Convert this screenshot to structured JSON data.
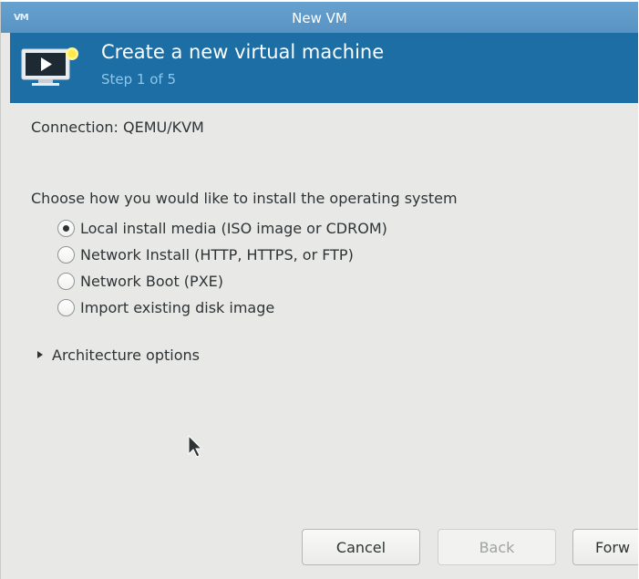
{
  "window": {
    "app_icon_text": "VM",
    "title": "New VM"
  },
  "header": {
    "title": "Create a new virtual machine",
    "step": "Step 1 of 5",
    "icon": "vm-monitor-icon"
  },
  "connection_label": "Connection: QEMU/KVM",
  "install_prompt": "Choose how you would like to install the operating system",
  "install_options": [
    {
      "label": "Local install media (ISO image or CDROM)",
      "checked": true
    },
    {
      "label": "Network Install (HTTP, HTTPS, or FTP)",
      "checked": false
    },
    {
      "label": "Network Boot (PXE)",
      "checked": false
    },
    {
      "label": "Import existing disk image",
      "checked": false
    }
  ],
  "architecture_label": "Architecture options",
  "buttons": {
    "cancel": "Cancel",
    "back": "Back",
    "forward": "Forw"
  },
  "colors": {
    "titlebar": "#5f9ac9",
    "header": "#1c6ea4",
    "step_text": "#8fc6ea",
    "body": "#e8e8e7"
  }
}
